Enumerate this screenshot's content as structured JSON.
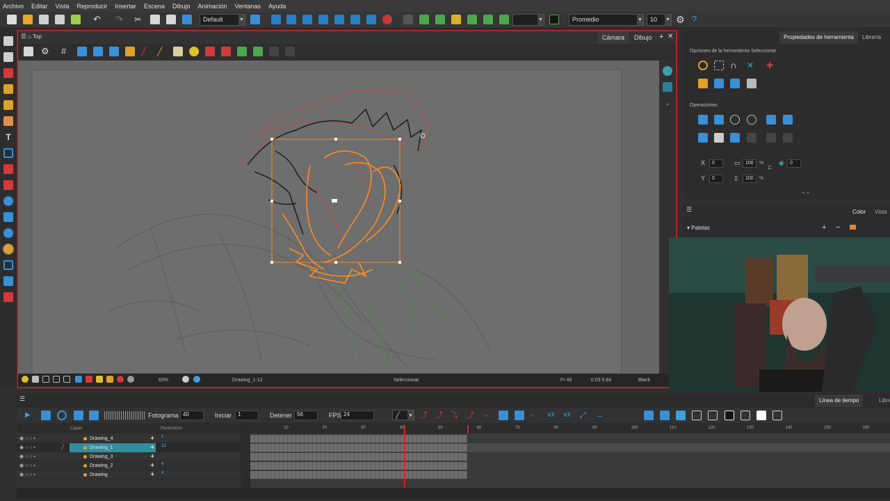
{
  "menu": [
    "Archivo",
    "Editar",
    "Vista",
    "Reproducir",
    "Insertar",
    "Escena",
    "Dibujo",
    "Animación",
    "Ventanas",
    "Ayuda"
  ],
  "toolbar": {
    "workspace": "Default",
    "smoothing_mode": "Promedio",
    "smoothing_value": "10"
  },
  "view": {
    "breadcrumb": "Top",
    "tab_camera": "Cámara",
    "tab_drawing": "Dibujo",
    "status": {
      "zoom": "63%",
      "drawing_name": "Drawing_1-12",
      "tool": "Seleccionar",
      "frame": "Fr 40",
      "coords": "0.03 6.84",
      "color": "Black"
    }
  },
  "tool_properties": {
    "tab": "Propiedades de herramienta",
    "tab_library": "Librería",
    "options_title": "Opciones de la herramienta Seleccionar",
    "operations_title": "Operaciones",
    "x": "0",
    "y": "0",
    "width": "100",
    "height": "100",
    "angle": "0",
    "percent": "%"
  },
  "color_panel": {
    "tab_color": "Color",
    "tab_view": "Vista",
    "palettes_label": "Paletas"
  },
  "timeline": {
    "tab_timeline": "Línea de tiempo",
    "tab_library": "Librería",
    "frame_label": "Fotograma",
    "frame_value": "40",
    "start_label": "Iniciar",
    "start_value": "1",
    "stop_label": "Detener",
    "stop_value": "56",
    "fps_label": "FPS",
    "fps_value": "24",
    "layers_header": "Capas",
    "params_header": "Parámetros",
    "layers": [
      {
        "name": "Drawing_4",
        "param": "1",
        "selected": false
      },
      {
        "name": "Drawing_1",
        "param": "12",
        "selected": true
      },
      {
        "name": "Drawing_3",
        "param": "",
        "selected": false
      },
      {
        "name": "Drawing_2",
        "param": "4",
        "selected": false
      },
      {
        "name": "Drawing",
        "param": "4",
        "selected": false
      }
    ],
    "ruler_ticks": [
      "10",
      "20",
      "30",
      "40",
      "50",
      "60",
      "70",
      "80",
      "90",
      "100",
      "110",
      "120",
      "130",
      "140",
      "150",
      "160"
    ]
  },
  "colors": {
    "accent_red": "#b2232c",
    "selection_orange": "#ff8a1f",
    "layer_selected": "#2f8fa0"
  }
}
